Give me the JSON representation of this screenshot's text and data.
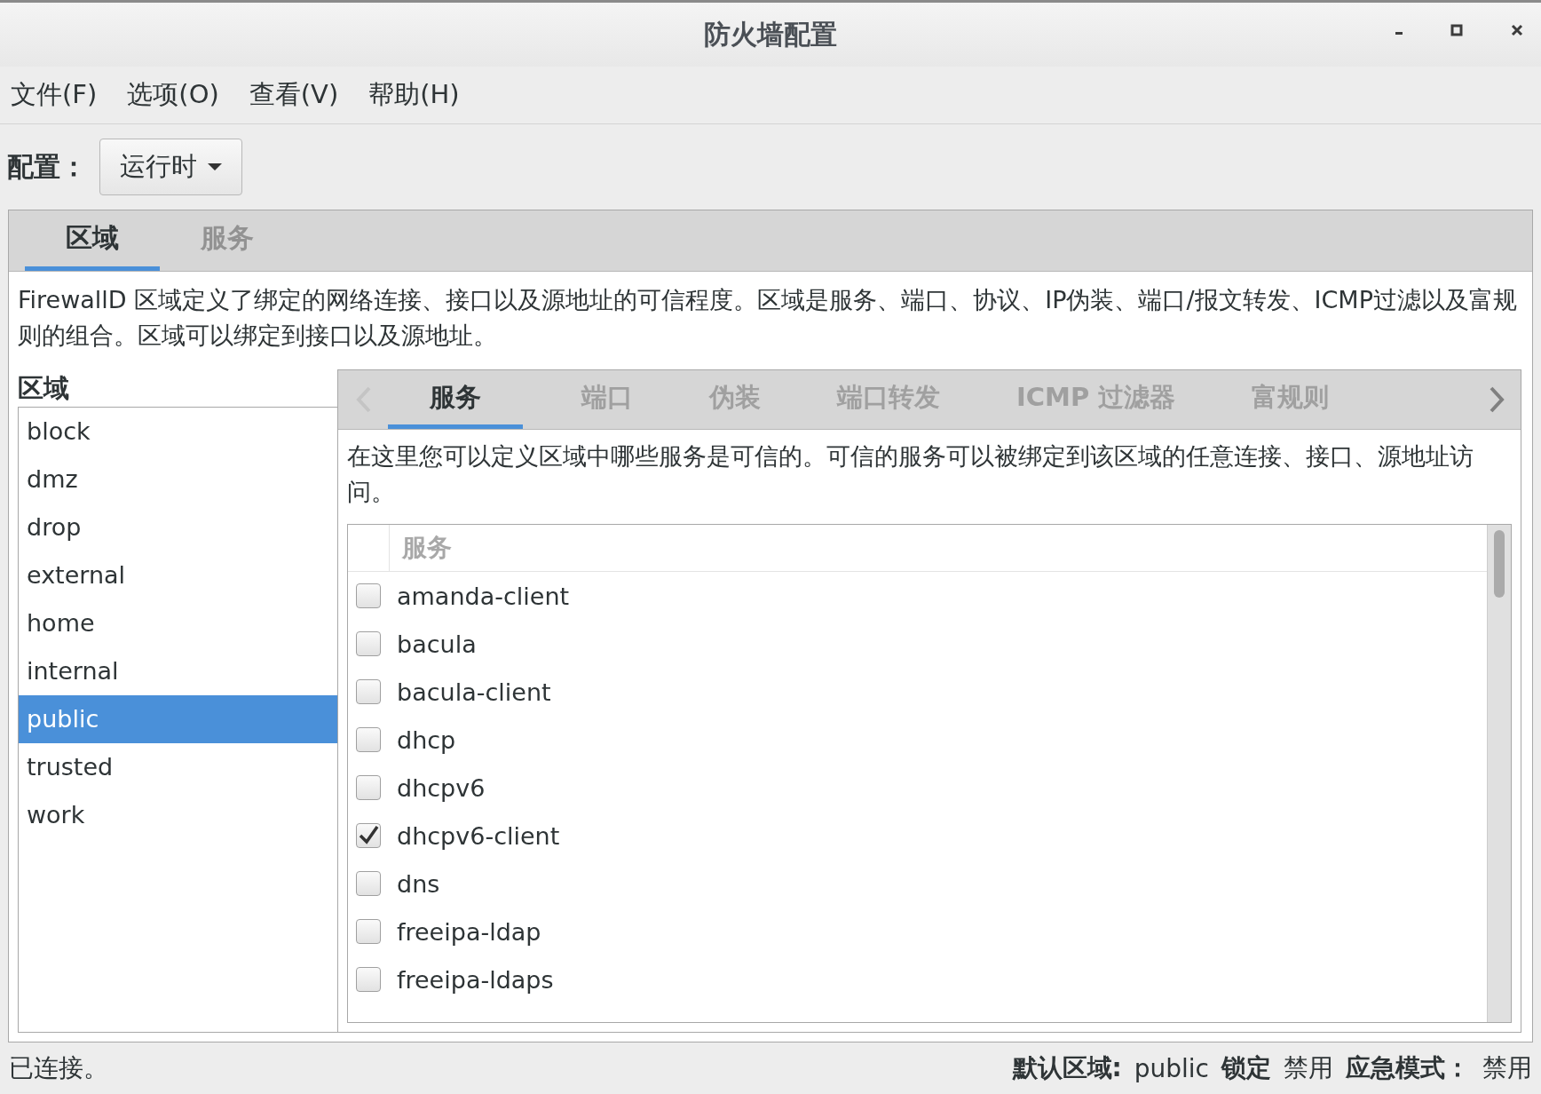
{
  "window": {
    "title": "防火墙配置"
  },
  "menu": [
    "文件(F)",
    "选项(O)",
    "查看(V)",
    "帮助(H)"
  ],
  "config": {
    "label": "配置：",
    "value": "运行时"
  },
  "main_tabs": [
    {
      "label": "区域",
      "selected": true
    },
    {
      "label": "服务",
      "selected": false
    }
  ],
  "description": "FirewallD 区域定义了绑定的网络连接、接口以及源地址的可信程度。区域是服务、端口、协议、IP伪装、端口/报文转发、ICMP过滤以及富规则的组合。区域可以绑定到接口以及源地址。",
  "zones": {
    "heading": "区域",
    "items": [
      {
        "label": "block",
        "selected": false
      },
      {
        "label": "dmz",
        "selected": false
      },
      {
        "label": "drop",
        "selected": false
      },
      {
        "label": "external",
        "selected": false
      },
      {
        "label": "home",
        "selected": false
      },
      {
        "label": "internal",
        "selected": false
      },
      {
        "label": "public",
        "selected": true
      },
      {
        "label": "trusted",
        "selected": false
      },
      {
        "label": "work",
        "selected": false
      }
    ]
  },
  "zone_tabs": [
    {
      "label": "服务",
      "selected": true
    },
    {
      "label": "端口",
      "selected": false
    },
    {
      "label": "伪装",
      "selected": false
    },
    {
      "label": "端口转发",
      "selected": false
    },
    {
      "label": "ICMP 过滤器",
      "selected": false
    },
    {
      "label": "富规则",
      "selected": false
    }
  ],
  "services": {
    "description": "在这里您可以定义区域中哪些服务是可信的。可信的服务可以被绑定到该区域的任意连接、接口、源地址访问。",
    "column": "服务",
    "rows": [
      {
        "name": "amanda-client",
        "checked": false
      },
      {
        "name": "bacula",
        "checked": false
      },
      {
        "name": "bacula-client",
        "checked": false
      },
      {
        "name": "dhcp",
        "checked": false
      },
      {
        "name": "dhcpv6",
        "checked": false
      },
      {
        "name": "dhcpv6-client",
        "checked": true
      },
      {
        "name": "dns",
        "checked": false
      },
      {
        "name": "freeipa-ldap",
        "checked": false
      },
      {
        "name": "freeipa-ldaps",
        "checked": false
      }
    ]
  },
  "status_bar": {
    "text": "已连接。",
    "items": [
      {
        "label": "默认区域:",
        "value": "public"
      },
      {
        "label": "锁定",
        "value": "禁用"
      },
      {
        "label": "应急模式：",
        "value": "禁用"
      }
    ]
  }
}
